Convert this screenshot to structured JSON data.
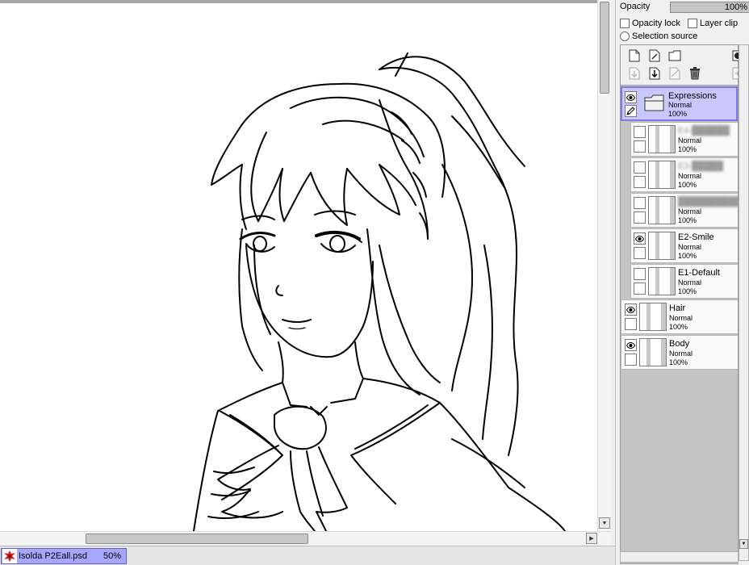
{
  "document": {
    "filename": "Isolda P2Eall.psd",
    "zoom": "50%"
  },
  "panel": {
    "opacity_label": "Opacity",
    "opacity_value": "100%",
    "opacity_lock_label": "Opacity lock",
    "layer_clip_label": "Layer clip",
    "selection_source_label": "Selection source"
  },
  "toolbar_icons": [
    "new-layer-icon",
    "new-linework-layer-icon",
    "new-folder-icon",
    "mask-icon",
    "transfer-down-icon",
    "merge-down-icon",
    "clear-layer-icon",
    "delete-layer-icon",
    "merge-visible-icon"
  ],
  "layers": [
    {
      "name": "Expressions",
      "mode": "Normal",
      "opacity": "100%",
      "type": "folder",
      "visible": true,
      "selected": true
    },
    {
      "name": "E4-██████",
      "mode": "Normal",
      "opacity": "100%",
      "visible": false,
      "redacted": true
    },
    {
      "name": "E3-█████",
      "mode": "Normal",
      "opacity": "100%",
      "visible": false,
      "redacted": true
    },
    {
      "name": "██████████",
      "mode": "Normal",
      "opacity": "100%",
      "visible": false,
      "redacted": true
    },
    {
      "name": "E2-Smile",
      "mode": "Normal",
      "opacity": "100%",
      "visible": true
    },
    {
      "name": "E1-Default",
      "mode": "Normal",
      "opacity": "100%",
      "visible": false
    },
    {
      "name": "Hair",
      "mode": "Normal",
      "opacity": "100%",
      "visible": true
    },
    {
      "name": "Body",
      "mode": "Normal",
      "opacity": "100%",
      "visible": true
    }
  ],
  "colors": {
    "selected_layer": "#c8c8ff",
    "doc_tab": "#a6a6ff"
  }
}
